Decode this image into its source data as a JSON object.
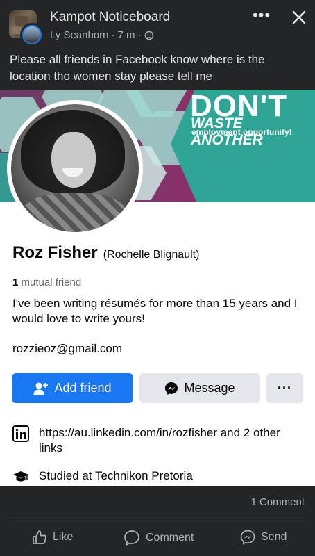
{
  "post": {
    "group_name": "Kampot Noticeboard",
    "author": "Ly Seanhorn",
    "time": "7 m",
    "separator": "·",
    "text": "Please all friends in Facebook know where is the location tho women stay please tell me"
  },
  "shared_profile": {
    "cover": {
      "headline": "DON'T",
      "subheadline": "WASTE ANOTHER",
      "tagline": "employment opportunity!"
    },
    "name": "Roz Fisher",
    "alt_name": "(Rochelle Blignault)",
    "mutual_count": "1",
    "mutual_label": "mutual friend",
    "bio": "I've been writing résumés for more than 15 years and I would love to write yours!",
    "email": "rozzieoz@gmail.com",
    "buttons": {
      "add_friend": "Add friend",
      "message": "Message",
      "more": "···"
    },
    "links": "https://au.linkedin.com/in/rozfisher and 2 other links",
    "education": "Studied at Technikon Pretoria"
  },
  "footer": {
    "comment_count": "1 Comment",
    "like": "Like",
    "comment": "Comment",
    "send": "Send"
  },
  "colors": {
    "accent": "#1877f2",
    "dark_bg": "#242526",
    "cover_purple": "#7c3d6f",
    "cover_teal": "#2fa596"
  }
}
